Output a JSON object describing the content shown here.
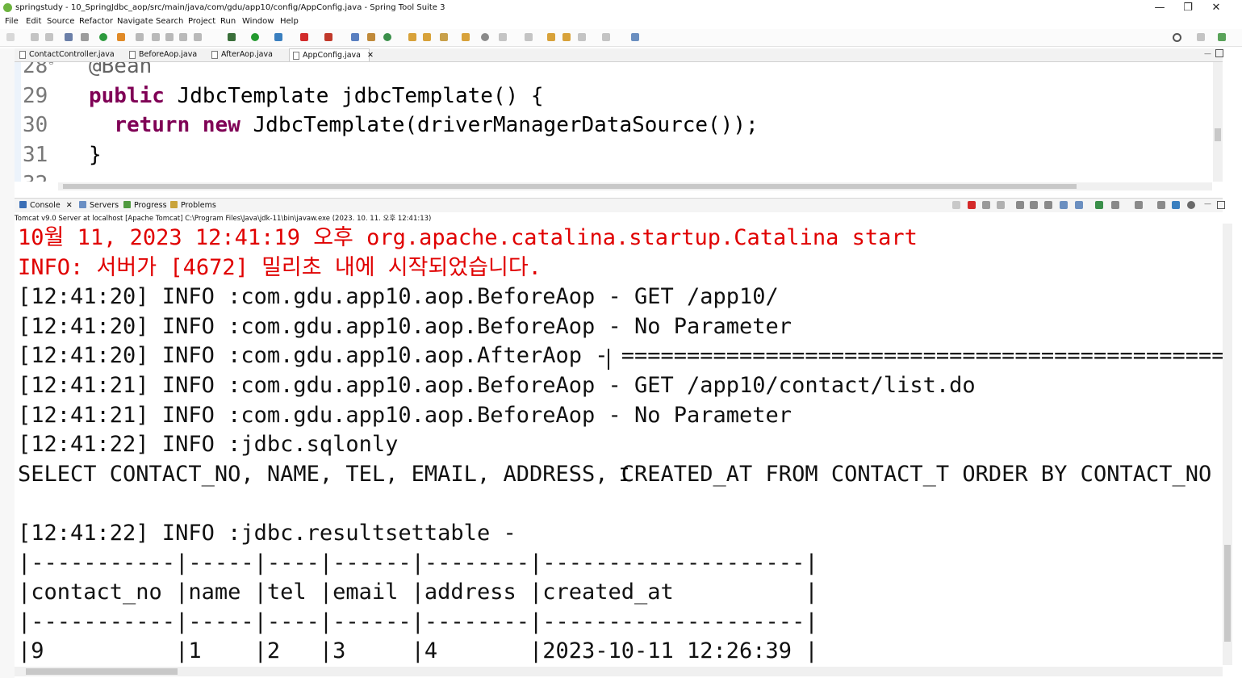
{
  "window": {
    "title": "springstudy - 10_SpringJdbc_aop/src/main/java/com/gdu/app10/config/AppConfig.java - Spring Tool Suite 3",
    "minimize_glyph": "—",
    "restore_glyph": "❐",
    "close_glyph": "✕"
  },
  "menu": [
    "File",
    "Edit",
    "Source",
    "Refactor",
    "Navigate",
    "Search",
    "Project",
    "Run",
    "Window",
    "Help"
  ],
  "editor_tabs": [
    {
      "label": "ContactController.java"
    },
    {
      "label": "BeforeAop.java"
    },
    {
      "label": "AfterAop.java"
    },
    {
      "label": "AppConfig.java",
      "active": true,
      "close": "✕"
    }
  ],
  "editor": {
    "lines": [
      {
        "no": "28",
        "marker": "⊖",
        "indent": "",
        "parts": [
          {
            "t": "@Bean",
            "c": "anno"
          }
        ]
      },
      {
        "no": "29",
        "indent": "",
        "parts": [
          {
            "t": "public",
            "c": "kw"
          },
          {
            "t": " JdbcTemplate jdbcTemplate() {",
            "c": ""
          }
        ]
      },
      {
        "no": "30",
        "indent": "  ",
        "parts": [
          {
            "t": "return",
            "c": "kw"
          },
          {
            "t": " ",
            "c": ""
          },
          {
            "t": "new",
            "c": "kw"
          },
          {
            "t": " JdbcTemplate(driverManagerDataSource());",
            "c": ""
          }
        ]
      },
      {
        "no": "31",
        "indent": "",
        "parts": [
          {
            "t": "}",
            "c": ""
          }
        ]
      },
      {
        "no": "32",
        "indent": "",
        "parts": []
      }
    ]
  },
  "console_tabs": [
    {
      "label": "Console",
      "close": "✕",
      "icon_color": "#3b6fb6"
    },
    {
      "label": "Servers",
      "icon_color": "#6a8fc4"
    },
    {
      "label": "Progress",
      "icon_color": "#4f9a3f"
    },
    {
      "label": "Problems",
      "icon_color": "#c9a33a"
    }
  ],
  "console_description": "Tomcat v9.0 Server at localhost [Apache Tomcat] C:\\Program Files\\Java\\jdk-11\\bin\\javaw.exe  (2023. 10. 11. 오후 12:41:13)",
  "console": {
    "lines": [
      {
        "text": "10월 11, 2023 12:41:19 오후 org.apache.catalina.startup.Catalina start",
        "err": true
      },
      {
        "text": "INFO: 서버가 [4672] 밀리초 내에 시작되었습니다.",
        "err": true
      },
      {
        "text": "[12:41:20] INFO :com.gdu.app10.aop.BeforeAop - GET /app10/",
        "err": false
      },
      {
        "text": "[12:41:20] INFO :com.gdu.app10.aop.BeforeAop - No Parameter",
        "err": false
      },
      {
        "text": "[12:41:20] INFO :com.gdu.app10.aop.AfterAop - ===================================================",
        "err": false
      },
      {
        "text": "[12:41:21] INFO :com.gdu.app10.aop.BeforeAop - GET /app10/contact/list.do",
        "err": false
      },
      {
        "text": "[12:41:21] INFO :com.gdu.app10.aop.BeforeAop - No Parameter",
        "err": false
      },
      {
        "text": "[12:41:22] INFO :jdbc.sqlonly",
        "err": false
      },
      {
        "text": "SELECT CONTACT_NO, NAME, TEL, EMAIL, ADDRESS, CREATED_AT FROM CONTACT_T ORDER BY CONTACT_NO AS",
        "err": false
      },
      {
        "text": "",
        "err": false
      },
      {
        "text": "[12:41:22] INFO :jdbc.resultsettable -",
        "err": false
      },
      {
        "text": "|-----------|-----|----|------|--------|--------------------|",
        "err": false
      },
      {
        "text": "|contact_no |name |tel |email |address |created_at          |",
        "err": false
      },
      {
        "text": "|-----------|-----|----|------|--------|--------------------|",
        "err": false
      },
      {
        "text": "|9          |1    |2   |3     |4       |2023-10-11 12:26:39 |",
        "err": false
      }
    ]
  },
  "misc": {
    "text_cursor_glyph": "I"
  }
}
